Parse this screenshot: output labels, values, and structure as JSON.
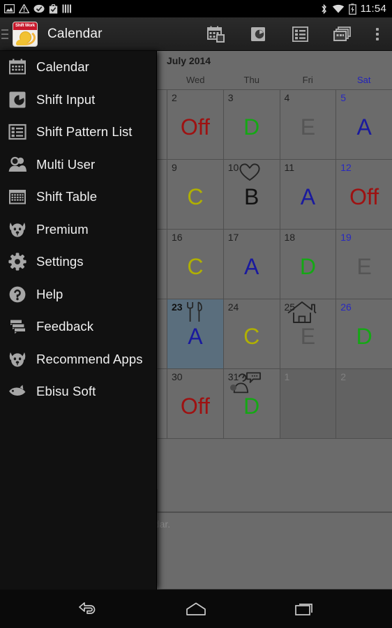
{
  "status_bar": {
    "time": "11:54",
    "left_icons": [
      "image-icon",
      "warning-icon",
      "check-circle-icon",
      "clipboard-check-icon",
      "bars-icon"
    ],
    "right_icons": [
      "bluetooth-icon",
      "wifi-icon",
      "battery-charging-icon"
    ]
  },
  "action_bar": {
    "logo_badge": "Shift Work",
    "title": "Calendar",
    "actions": [
      "calendar-view-icon",
      "clock-shift-icon",
      "list-view-icon",
      "multi-card-icon",
      "overflow-menu-icon"
    ]
  },
  "drawer": {
    "items": [
      {
        "label": "Calendar",
        "icon": "calendar-icon"
      },
      {
        "label": "Shift Input",
        "icon": "clock-shift-icon"
      },
      {
        "label": "Shift Pattern List",
        "icon": "list-view-icon"
      },
      {
        "label": "Multi User",
        "icon": "users-icon"
      },
      {
        "label": "Shift Table",
        "icon": "table-icon"
      },
      {
        "label": "Premium",
        "icon": "dog-icon"
      },
      {
        "label": "Settings",
        "icon": "gear-icon"
      },
      {
        "label": "Help",
        "icon": "question-circle-icon"
      },
      {
        "label": "Feedback",
        "icon": "chat-bubbles-icon"
      },
      {
        "label": "Recommend Apps",
        "icon": "dog-icon"
      },
      {
        "label": "Ebisu Soft",
        "icon": "fish-icon"
      }
    ]
  },
  "calendar": {
    "month_title": "July 2014",
    "visible_day_headers": [
      "Wed",
      "Thu",
      "Fri",
      "Sat"
    ],
    "saturday_header": "Sat",
    "colors": {
      "off": "#9e1111",
      "shift_d": "#14a814",
      "shift_e": "#555555",
      "shift_a": "#1a1a9e",
      "shift_b": "#111111",
      "shift_c": "#b0b000",
      "today_bg": "#5a6e7d",
      "saturday": "#2828c0",
      "other_month": "#808080"
    },
    "weeks": [
      [
        {
          "day": "2",
          "shift": "Off",
          "shift_color": "#9e1111",
          "sat": false,
          "today": false,
          "other": false,
          "icon": null,
          "dot": false
        },
        {
          "day": "3",
          "shift": "D",
          "shift_color": "#14a814",
          "sat": false,
          "today": false,
          "other": false,
          "icon": null,
          "dot": false
        },
        {
          "day": "4",
          "shift": "E",
          "shift_color": "#555555",
          "sat": false,
          "today": false,
          "other": false,
          "icon": null,
          "dot": false
        },
        {
          "day": "5",
          "shift": "A",
          "shift_color": "#1a1a9e",
          "sat": true,
          "today": false,
          "other": false,
          "icon": null,
          "dot": false
        }
      ],
      [
        {
          "day": "9",
          "shift": "C",
          "shift_color": "#b0b000",
          "sat": false,
          "today": false,
          "other": false,
          "icon": null,
          "dot": false
        },
        {
          "day": "10",
          "shift": "B",
          "shift_color": "#111111",
          "sat": false,
          "today": false,
          "other": false,
          "icon": "heart-icon",
          "dot": false
        },
        {
          "day": "11",
          "shift": "A",
          "shift_color": "#1a1a9e",
          "sat": false,
          "today": false,
          "other": false,
          "icon": null,
          "dot": false
        },
        {
          "day": "12",
          "shift": "Off",
          "shift_color": "#9e1111",
          "sat": true,
          "today": false,
          "other": false,
          "icon": null,
          "dot": false
        }
      ],
      [
        {
          "day": "16",
          "shift": "C",
          "shift_color": "#b0b000",
          "sat": false,
          "today": false,
          "other": false,
          "icon": null,
          "dot": false
        },
        {
          "day": "17",
          "shift": "A",
          "shift_color": "#1a1a9e",
          "sat": false,
          "today": false,
          "other": false,
          "icon": null,
          "dot": false
        },
        {
          "day": "18",
          "shift": "D",
          "shift_color": "#14a814",
          "sat": false,
          "today": false,
          "other": false,
          "icon": null,
          "dot": false
        },
        {
          "day": "19",
          "shift": "E",
          "shift_color": "#555555",
          "sat": true,
          "today": false,
          "other": false,
          "icon": null,
          "dot": false
        }
      ],
      [
        {
          "day": "23",
          "shift": "A",
          "shift_color": "#1a1a9e",
          "sat": false,
          "today": true,
          "other": false,
          "icon": "cutlery-icon",
          "dot": false
        },
        {
          "day": "24",
          "shift": "C",
          "shift_color": "#b0b000",
          "sat": false,
          "today": false,
          "other": false,
          "icon": null,
          "dot": false
        },
        {
          "day": "25",
          "shift": "E",
          "shift_color": "#555555",
          "sat": false,
          "today": false,
          "other": false,
          "icon": "home-icon",
          "dot": false
        },
        {
          "day": "26",
          "shift": "D",
          "shift_color": "#14a814",
          "sat": true,
          "today": false,
          "other": false,
          "icon": null,
          "dot": false
        }
      ],
      [
        {
          "day": "30",
          "shift": "Off",
          "shift_color": "#9e1111",
          "sat": false,
          "today": false,
          "other": false,
          "icon": null,
          "dot": false
        },
        {
          "day": "31",
          "shift": "D",
          "shift_color": "#14a814",
          "sat": false,
          "today": false,
          "other": false,
          "icon": "person-speech-icon",
          "dot": true
        },
        {
          "day": "1",
          "shift": "",
          "shift_color": "#808080",
          "sat": false,
          "today": false,
          "other": true,
          "icon": null,
          "dot": false
        },
        {
          "day": "2",
          "shift": "",
          "shift_color": "#808080",
          "sat": true,
          "today": false,
          "other": true,
          "icon": null,
          "dot": false
        }
      ]
    ],
    "below_text": "ndar."
  },
  "nav_bar": {
    "buttons": [
      "back-icon",
      "home-icon",
      "recents-icon"
    ]
  }
}
